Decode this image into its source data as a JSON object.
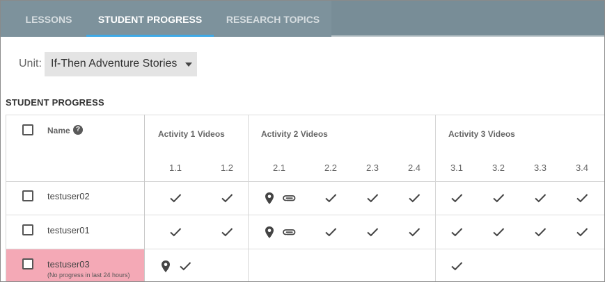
{
  "tabs": [
    {
      "label": "LESSONS",
      "active": false
    },
    {
      "label": "STUDENT PROGRESS",
      "active": true
    },
    {
      "label": "RESEARCH TOPICS",
      "active": false
    }
  ],
  "unit": {
    "label": "Unit:",
    "selected": "If-Then Adventure Stories"
  },
  "section_title": "STUDENT PROGRESS",
  "table": {
    "name_header": "Name",
    "help_glyph": "?",
    "activities": [
      {
        "label": "Activity 1 Videos",
        "videos": [
          "1.1",
          "1.2"
        ]
      },
      {
        "label": "Activity 2 Videos",
        "videos": [
          "2.1",
          "2.2",
          "2.3",
          "2.4"
        ]
      },
      {
        "label": "Activity 3 Videos",
        "videos": [
          "3.1",
          "3.2",
          "3.3",
          "3.4"
        ]
      }
    ],
    "rows": [
      {
        "name": "testuser02",
        "note": "",
        "flagged": false,
        "cells": [
          "check",
          "check",
          "pin-clip",
          "check",
          "check",
          "check",
          "check",
          "check",
          "check",
          "check"
        ]
      },
      {
        "name": "testuser01",
        "note": "",
        "flagged": false,
        "cells": [
          "check",
          "check",
          "pin-clip",
          "check",
          "check",
          "check",
          "check",
          "check",
          "check",
          "check"
        ]
      },
      {
        "name": "testuser03",
        "note": "(No progress in last 24 hours)",
        "flagged": true,
        "cells": [
          "pin-check",
          "",
          "",
          "",
          "",
          "",
          "check",
          "",
          "",
          ""
        ]
      }
    ]
  },
  "icons": {
    "check": "checkmark-icon",
    "pin": "location-pin-icon",
    "clip": "paperclip-icon",
    "help": "help-circle-icon",
    "caret": "caret-down-icon"
  },
  "colors": {
    "tab_bar": "#7d929c",
    "tab_underline": "#3ea9e6",
    "flag_row": "#f4a9b6",
    "icon": "#444444"
  }
}
